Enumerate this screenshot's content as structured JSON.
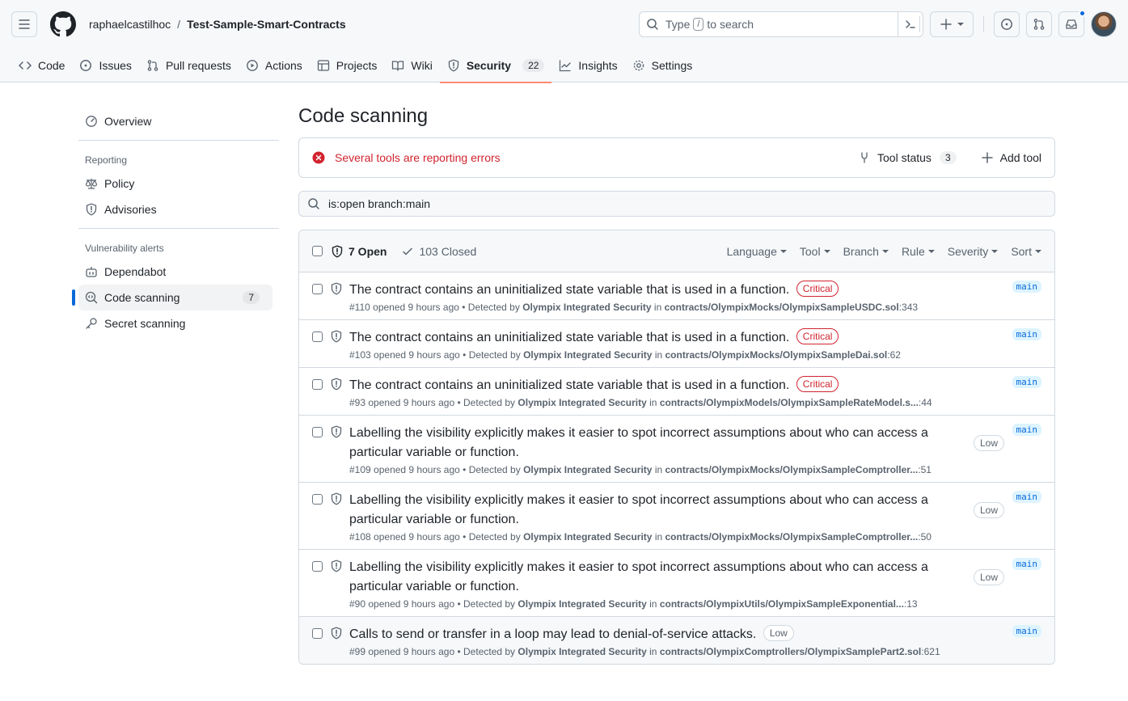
{
  "header": {
    "owner": "raphaelcastilhoc",
    "separator": "/",
    "repo": "Test-Sample-Smart-Contracts",
    "search_prefix": "Type",
    "search_key": "/",
    "search_suffix": "to search"
  },
  "tabs": [
    {
      "label": "Code",
      "icon": "code-icon"
    },
    {
      "label": "Issues",
      "icon": "issue-icon"
    },
    {
      "label": "Pull requests",
      "icon": "pull-request-icon"
    },
    {
      "label": "Actions",
      "icon": "play-icon"
    },
    {
      "label": "Projects",
      "icon": "table-icon"
    },
    {
      "label": "Wiki",
      "icon": "book-icon"
    },
    {
      "label": "Security",
      "icon": "shield-icon",
      "count": "22"
    },
    {
      "label": "Insights",
      "icon": "graph-icon"
    },
    {
      "label": "Settings",
      "icon": "gear-icon"
    }
  ],
  "sidebar": {
    "overview": "Overview",
    "reporting_heading": "Reporting",
    "policy": "Policy",
    "advisories": "Advisories",
    "alerts_heading": "Vulnerability alerts",
    "dependabot": "Dependabot",
    "code_scanning": "Code scanning",
    "code_scanning_count": "7",
    "secret_scanning": "Secret scanning"
  },
  "main": {
    "title": "Code scanning",
    "error_text": "Several tools are reporting errors",
    "tool_status_label": "Tool status",
    "tool_status_count": "3",
    "add_tool_label": "Add tool",
    "filter_value": "is:open branch:main",
    "open_label": "7 Open",
    "closed_label": "103 Closed",
    "filters": [
      "Language",
      "Tool",
      "Branch",
      "Rule",
      "Severity",
      "Sort"
    ]
  },
  "alerts": [
    {
      "title": "The contract contains an uninitialized state variable that is used in a function.",
      "severity": "Critical",
      "number": "#110",
      "opened": "opened 9 hours ago",
      "detected": "• Detected by",
      "tool": "Olympix Integrated Security",
      "in": "in",
      "path": "contracts/OlympixMocks/OlympixSampleUSDC.sol",
      "line": ":343",
      "branch": "main"
    },
    {
      "title": "The contract contains an uninitialized state variable that is used in a function.",
      "severity": "Critical",
      "number": "#103",
      "opened": "opened 9 hours ago",
      "detected": "• Detected by",
      "tool": "Olympix Integrated Security",
      "in": "in",
      "path": "contracts/OlympixMocks/OlympixSampleDai.sol",
      "line": ":62",
      "branch": "main"
    },
    {
      "title": "The contract contains an uninitialized state variable that is used in a function.",
      "severity": "Critical",
      "number": "#93",
      "opened": "opened 9 hours ago",
      "detected": "• Detected by",
      "tool": "Olympix Integrated Security",
      "in": "in",
      "path": "contracts/OlympixModels/OlympixSampleRateModel.s...",
      "line": ":44",
      "branch": "main"
    },
    {
      "title": "Labelling the visibility explicitly makes it easier to spot incorrect assumptions about who can access a particular variable or function.",
      "severity": "Low",
      "number": "#109",
      "opened": "opened 9 hours ago",
      "detected": "• Detected by",
      "tool": "Olympix Integrated Security",
      "in": "in",
      "path": "contracts/OlympixMocks/OlympixSampleComptroller...",
      "line": ":51",
      "branch": "main"
    },
    {
      "title": "Labelling the visibility explicitly makes it easier to spot incorrect assumptions about who can access a particular variable or function.",
      "severity": "Low",
      "number": "#108",
      "opened": "opened 9 hours ago",
      "detected": "• Detected by",
      "tool": "Olympix Integrated Security",
      "in": "in",
      "path": "contracts/OlympixMocks/OlympixSampleComptroller...",
      "line": ":50",
      "branch": "main"
    },
    {
      "title": "Labelling the visibility explicitly makes it easier to spot incorrect assumptions about who can access a particular variable or function.",
      "severity": "Low",
      "number": "#90",
      "opened": "opened 9 hours ago",
      "detected": "• Detected by",
      "tool": "Olympix Integrated Security",
      "in": "in",
      "path": "contracts/OlympixUtils/OlympixSampleExponential...",
      "line": ":13",
      "branch": "main"
    },
    {
      "title": "Calls to send or transfer in a loop may lead to denial-of-service attacks.",
      "severity": "Low",
      "number": "#99",
      "opened": "opened 9 hours ago",
      "detected": "• Detected by",
      "tool": "Olympix Integrated Security",
      "in": "in",
      "path": "contracts/OlympixComptrollers/OlympixSamplePart2.sol",
      "line": ":621",
      "branch": "main"
    }
  ],
  "colors": {
    "accent": "#0969da",
    "critical": "#d1242f",
    "tab_underline": "#fd8c73"
  }
}
